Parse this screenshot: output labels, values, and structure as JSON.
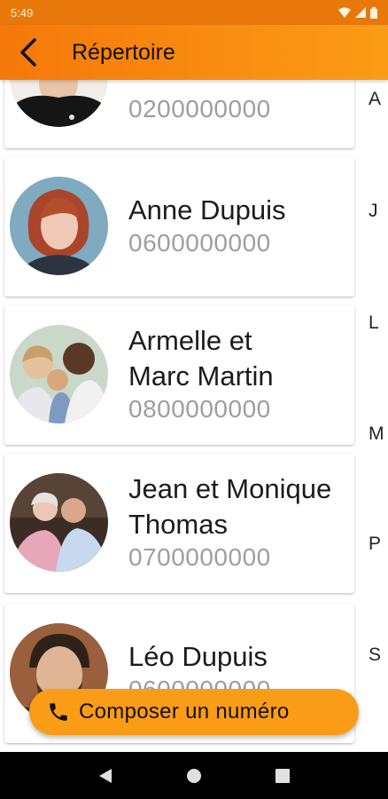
{
  "status_bar": {
    "time": "5:49"
  },
  "app_bar": {
    "title": "Répertoire"
  },
  "contacts": [
    {
      "name": "",
      "phone": "0200000000"
    },
    {
      "name": "Anne Dupuis",
      "phone": "0600000000"
    },
    {
      "name_line1": "Armelle et",
      "name_line2": "Marc Martin",
      "phone": "0800000000"
    },
    {
      "name_line1": "Jean et Monique",
      "name_line2": "Thomas",
      "phone": "0700000000"
    },
    {
      "name": "Léo Dupuis",
      "phone": "0600000000"
    }
  ],
  "index_letters": [
    "A",
    "J",
    "L",
    "M",
    "P",
    "S"
  ],
  "fab": {
    "label": "Composer un numéro"
  },
  "colors": {
    "accent": "#fb9c16",
    "accent_dark": "#f5780a",
    "phone_text": "#9e9e9e"
  },
  "icons": [
    "back-arrow-icon",
    "phone-icon",
    "wifi-icon",
    "signal-icon",
    "battery-icon",
    "nav-back-icon",
    "nav-home-icon",
    "nav-recents-icon"
  ]
}
